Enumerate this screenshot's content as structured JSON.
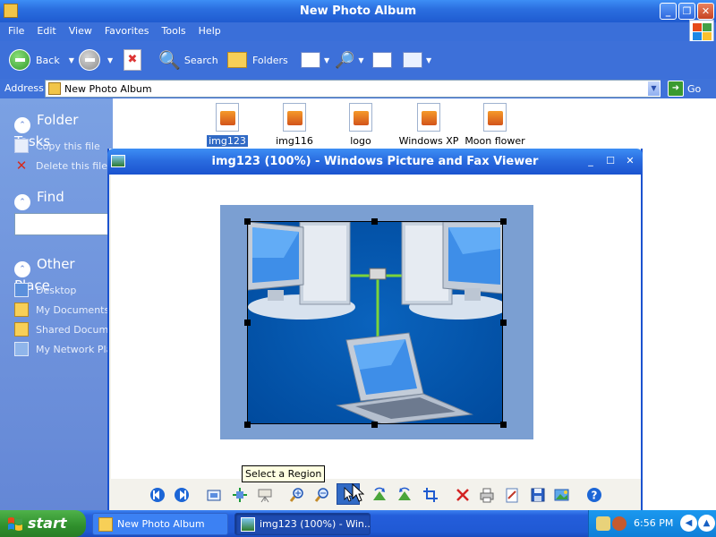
{
  "explorer": {
    "title": "New Photo Album",
    "menu": [
      "File",
      "Edit",
      "View",
      "Favorites",
      "Tools",
      "Help"
    ],
    "toolbar": {
      "back": "Back",
      "search": "Search",
      "folders": "Folders"
    },
    "address_label": "Address",
    "address_value": "New Photo Album",
    "go_label": "Go",
    "tasks": {
      "folder_tasks": "Folder Tasks",
      "copy": "Copy this file",
      "delete": "Delete this file",
      "find": "Find",
      "other_places": "Other Place",
      "places": [
        "Desktop",
        "My Documents",
        "Shared Docume",
        "My Network Pla"
      ]
    },
    "files": [
      "img123",
      "img116",
      "logo",
      "Windows XP",
      "Moon flower"
    ]
  },
  "viewer": {
    "title": "img123 (100%) - Windows Picture and Fax Viewer",
    "tooltip": "Select a Region"
  },
  "taskbar": {
    "start": "start",
    "tasks": [
      "New Photo Album",
      "img123 (100%) - Win..."
    ],
    "clock": "6:56 PM"
  }
}
